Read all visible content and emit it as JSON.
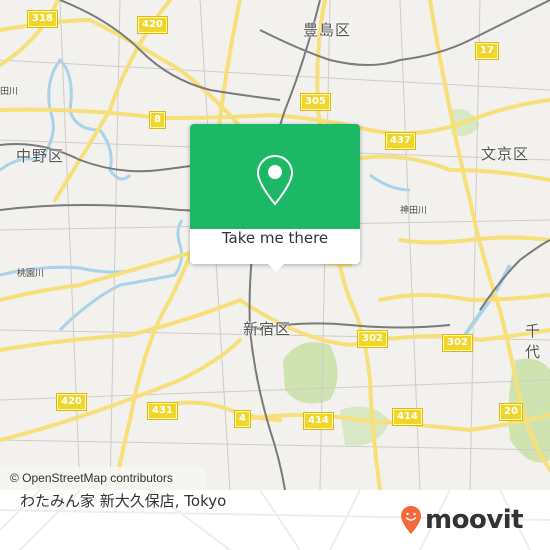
{
  "map": {
    "ward_labels": [
      {
        "id": "toshima",
        "text": "豊島区"
      },
      {
        "id": "nakano",
        "text": "中野区"
      },
      {
        "id": "bunkyo",
        "text": "文京区"
      },
      {
        "id": "shinjuku",
        "text": "新宿区"
      },
      {
        "id": "chiyoda",
        "text": "千代"
      }
    ],
    "small_labels": [
      {
        "id": "river-1",
        "text": "田川"
      },
      {
        "id": "river-2",
        "text": "桃園川"
      },
      {
        "id": "river-3",
        "text": "神田川"
      }
    ],
    "route_shields": [
      "318",
      "420",
      "8",
      "305",
      "437",
      "17",
      "420",
      "431",
      "4",
      "302",
      "302",
      "414",
      "414",
      "20"
    ],
    "attribution": "© OpenStreetMap contributors",
    "colors": {
      "road": "#f7e07a",
      "land": "#f2f1ee",
      "water": "#a9d3e8",
      "park": "#cfe3b0",
      "rail": "#777777"
    }
  },
  "popup": {
    "icon": "map-pin-icon",
    "button_label": "Take me there",
    "accent_color": "#1db865"
  },
  "footer": {
    "place_name": "わたみん家 新大久保店, Tokyo",
    "logo_text": "moovit",
    "logo_color": "#f26a3a"
  }
}
